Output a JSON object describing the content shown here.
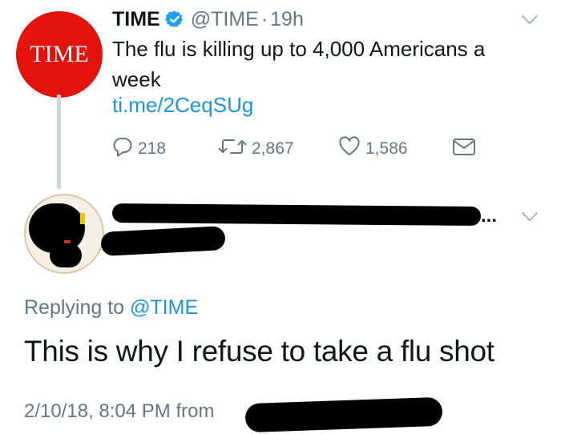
{
  "tweet": {
    "avatar_text": "TIME",
    "display_name": "TIME",
    "handle": "@TIME",
    "separator": "·",
    "time_ago": "19h",
    "text": "The flu is killing up to 4,000 Americans a week",
    "link": "ti.me/2CeqSUg",
    "actions": {
      "replies": "218",
      "retweets": "2,867",
      "likes": "1,586"
    }
  },
  "reply": {
    "name_truncation": "...",
    "replying_to_prefix": "Replying to",
    "replying_to_handle": "@TIME",
    "text": "This is why I refuse to take a flu shot",
    "timestamp": "2/10/18, 8:04 PM",
    "source_prefix": "from"
  },
  "colors": {
    "time_red": "#e3120b",
    "link_blue": "#1b95e0",
    "muted_gray": "#657786",
    "verified_blue": "#1da1f2"
  },
  "icons": [
    "verified-badge-icon",
    "chevron-down-icon",
    "reply-icon",
    "retweet-icon",
    "like-icon",
    "direct-message-icon"
  ]
}
